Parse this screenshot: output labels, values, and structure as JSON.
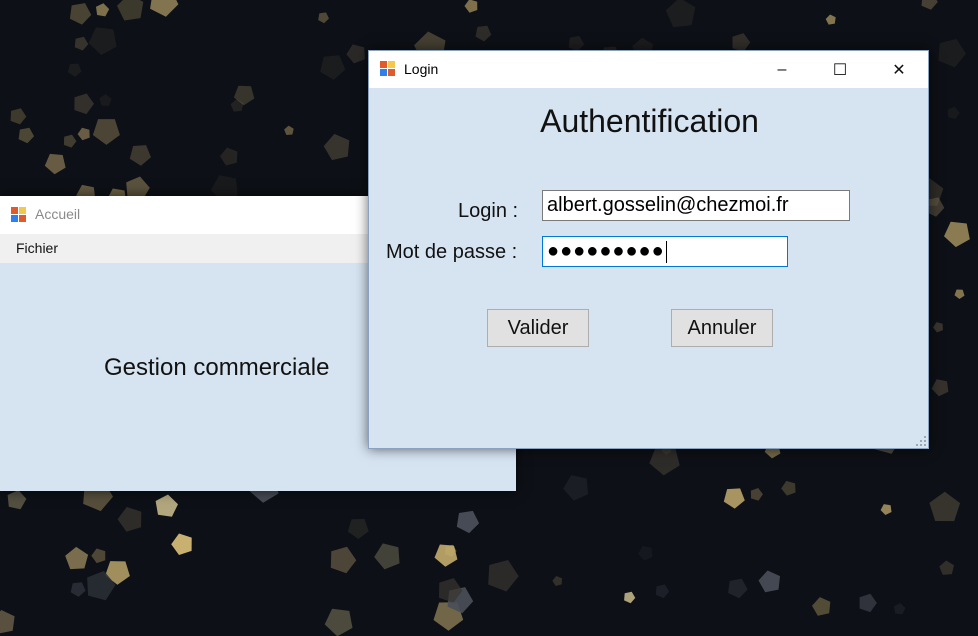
{
  "desktop": {
    "background": "dark bokeh wallpaper"
  },
  "accueil_window": {
    "title": "Accueil",
    "menu": [
      "Fichier"
    ],
    "main_label": "Gestion commerciale"
  },
  "login_window": {
    "title": "Login",
    "heading": "Authentification",
    "login_label": "Login :",
    "login_value": "albert.gosselin@chezmoi.fr",
    "password_label": "Mot de passe :",
    "password_masked": "●●●●●●●●●",
    "buttons": {
      "validate": "Valider",
      "cancel": "Annuler"
    },
    "controls": {
      "minimize": "–",
      "maximize": "☐",
      "close": "✕"
    }
  },
  "colors": {
    "form_background": "#d6e4f2",
    "titlebar": "#ffffff",
    "focus_border": "#0078d7"
  }
}
